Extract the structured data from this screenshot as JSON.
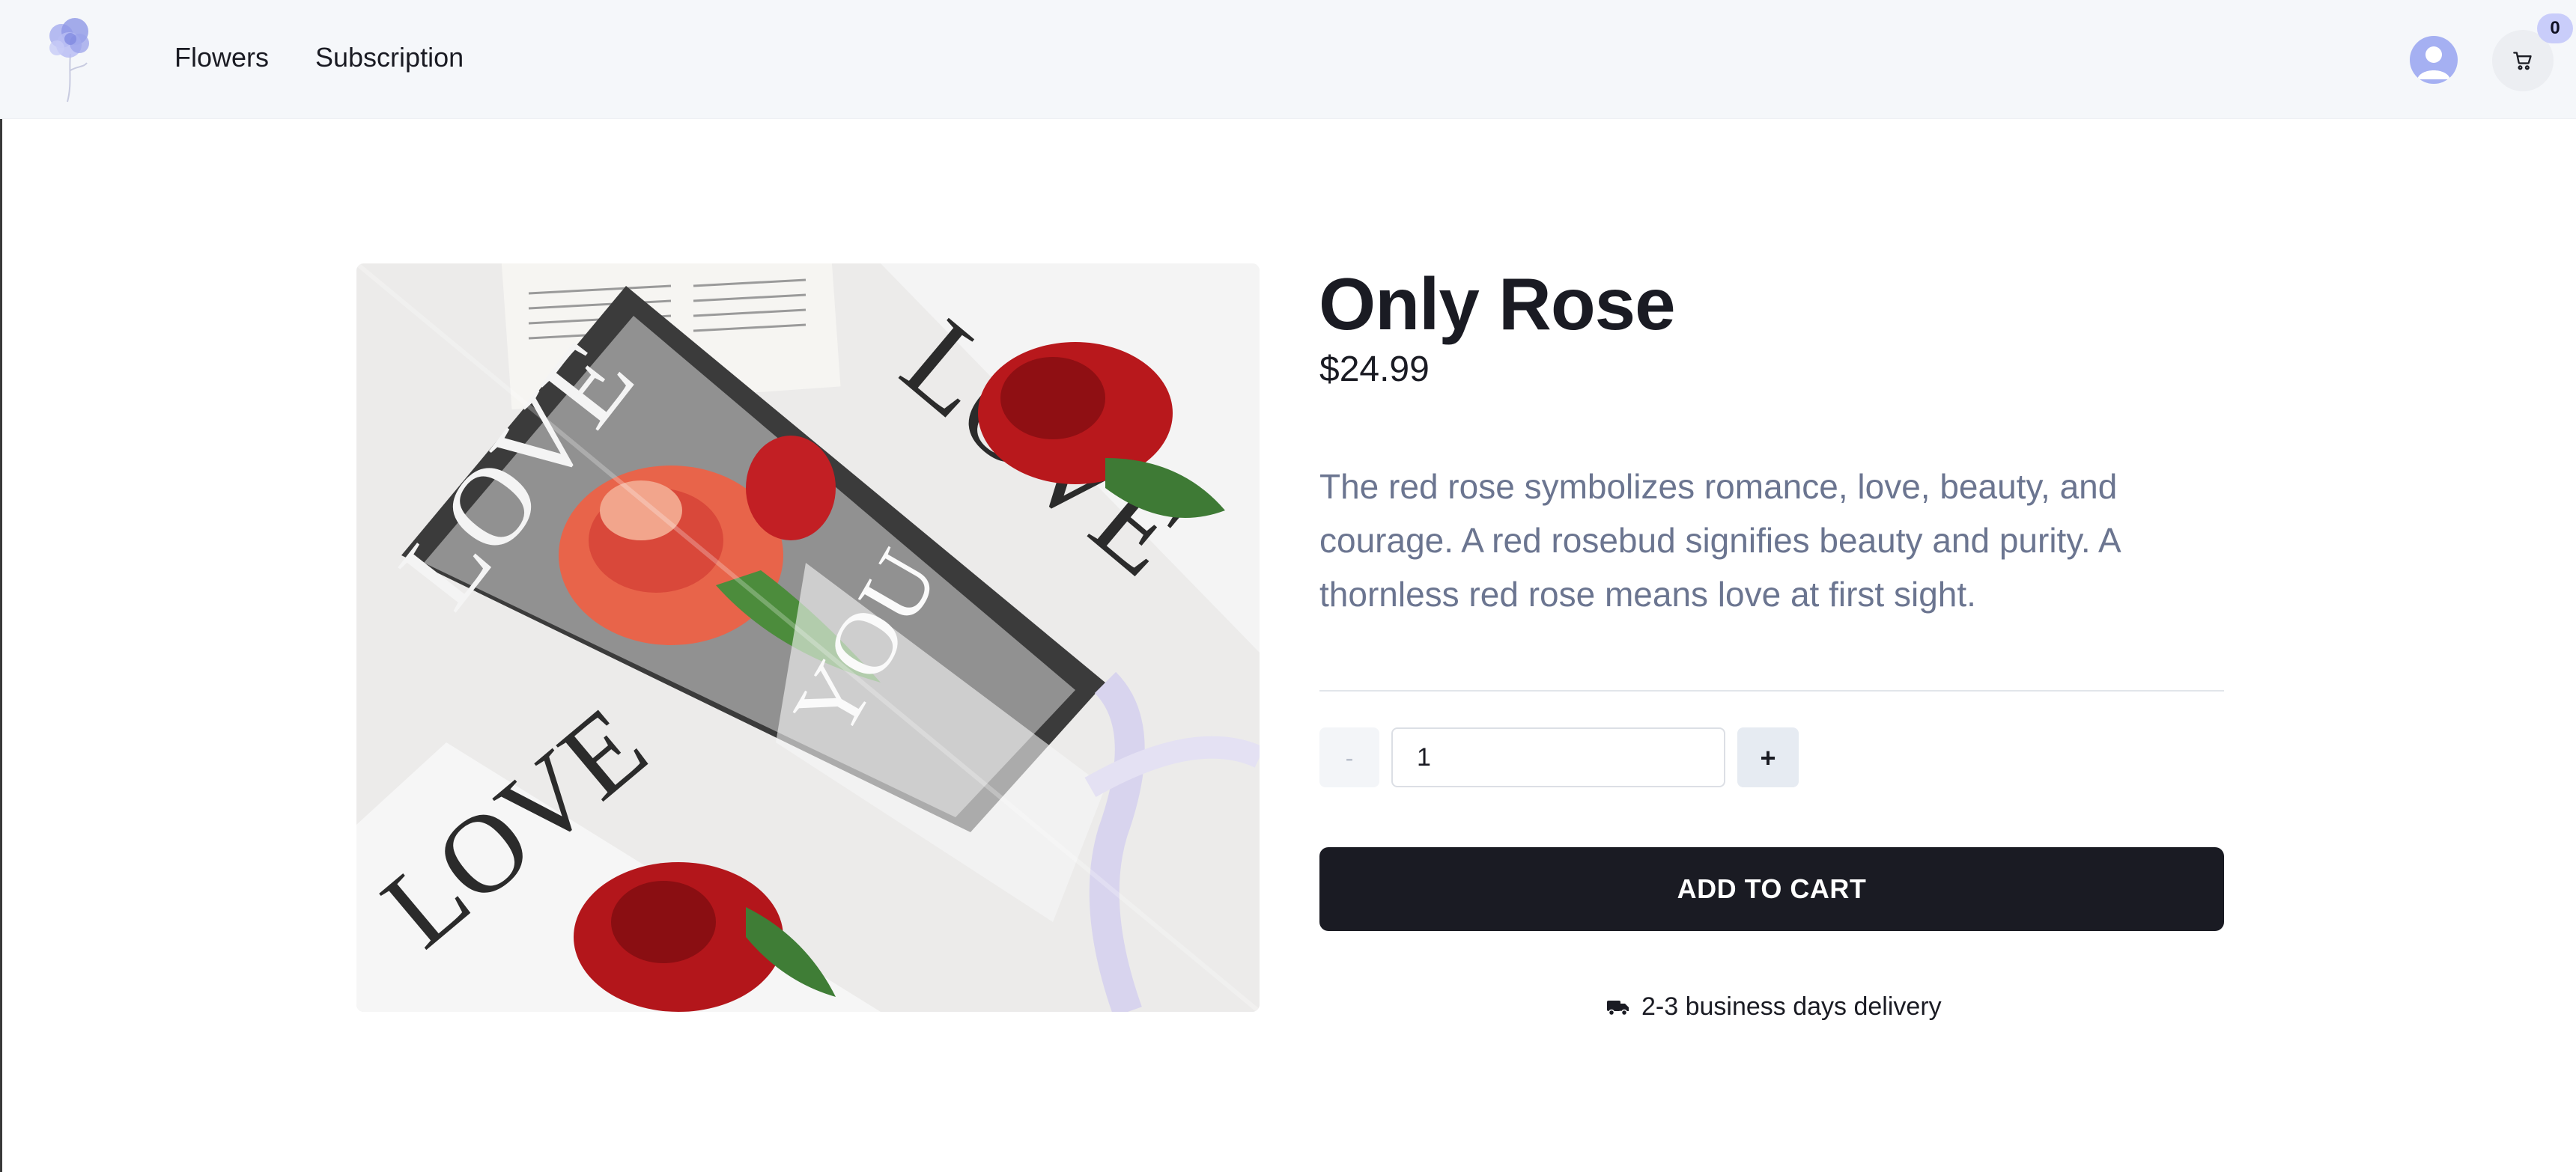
{
  "header": {
    "nav": [
      {
        "label": "Flowers"
      },
      {
        "label": "Subscription"
      }
    ],
    "cart_count": "0",
    "logo_icon": "flower-logo",
    "account_icon": "user-avatar-icon",
    "cart_icon": "shopping-cart-icon"
  },
  "product": {
    "title": "Only Rose",
    "price": "$24.99",
    "description": "The red rose symbolizes romance, love, beauty, and courage. A red rosebud signifies beauty and purity. A thornless red rose means love at first sight.",
    "quantity": "1",
    "decrement_label": "-",
    "increment_label": "+",
    "add_to_cart_label": "ADD TO CART",
    "delivery_text": "2-3 business days delivery",
    "delivery_icon": "truck-icon"
  },
  "colors": {
    "header_bg": "#f5f7fa",
    "primary_button": "#1a1b23",
    "description_text": "#6b7590",
    "badge_bg": "#c9cdfa",
    "avatar_bg": "#a5b0f2"
  }
}
